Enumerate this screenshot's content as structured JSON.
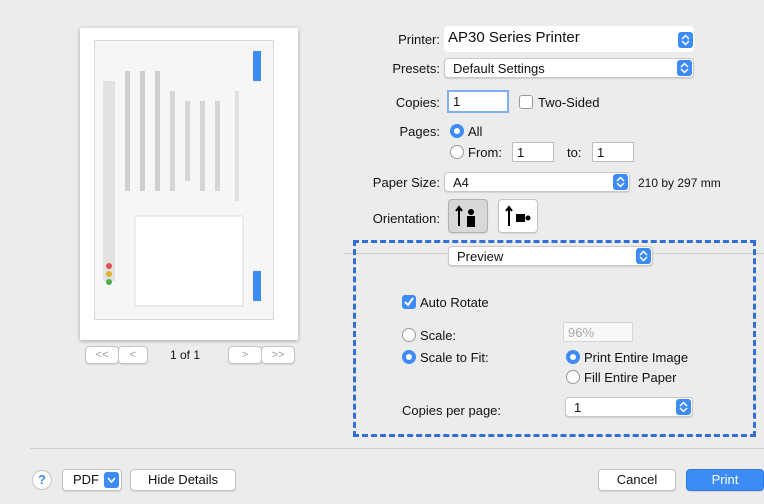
{
  "printer": {
    "label": "Printer:",
    "value": "AP30 Series Printer"
  },
  "presets": {
    "label": "Presets:",
    "value": "Default Settings"
  },
  "copies": {
    "label": "Copies:",
    "value": "1",
    "two_sided": "Two-Sided"
  },
  "pages": {
    "label": "Pages:",
    "all": "All",
    "from": "From:",
    "from_value": "1",
    "to": "to:",
    "to_value": "1"
  },
  "paper_size": {
    "label": "Paper Size:",
    "value": "A4",
    "dimensions": "210 by 297 mm"
  },
  "orientation": {
    "label": "Orientation:"
  },
  "section": {
    "value": "Preview"
  },
  "preview_options": {
    "auto_rotate": "Auto Rotate",
    "scale": "Scale:",
    "scale_value": "96%",
    "scale_to_fit": "Scale to Fit:",
    "print_entire_image": "Print Entire Image",
    "fill_entire_paper": "Fill Entire Paper",
    "copies_per_page": "Copies per page:",
    "copies_per_page_value": "1"
  },
  "pager": {
    "first": "<<",
    "prev": "<",
    "page_indicator": "1 of 1",
    "next": ">",
    "last": ">>"
  },
  "footer": {
    "help": "?",
    "pdf": "PDF",
    "hide_details": "Hide Details",
    "cancel": "Cancel",
    "print": "Print"
  },
  "colors": {
    "accent": "#3d8cf5",
    "dash": "#2f6fd6"
  }
}
